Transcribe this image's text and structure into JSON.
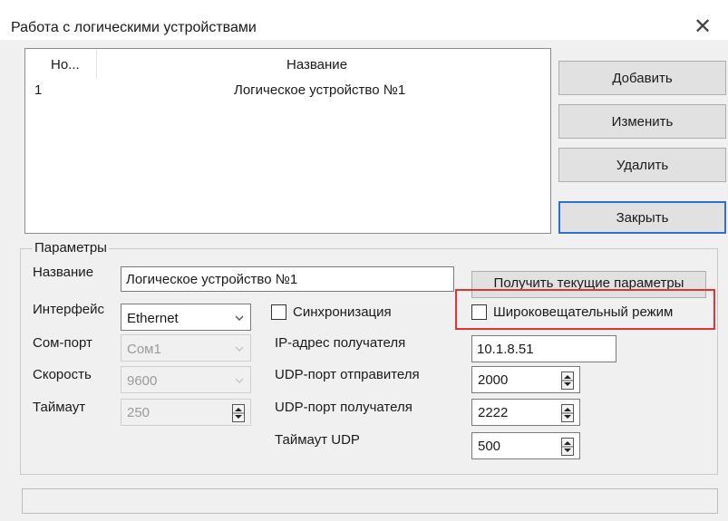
{
  "window": {
    "title": "Работа с логическими устройствами",
    "close_glyph": "✕"
  },
  "list": {
    "columns": [
      "Но...",
      "Название"
    ],
    "rows": [
      {
        "no": "1",
        "name": "Логическое устройство №1"
      }
    ]
  },
  "buttons": {
    "add": "Добавить",
    "edit": "Изменить",
    "delete": "Удалить",
    "close": "Закрыть",
    "get_params": "Получить текущие параметры"
  },
  "params": {
    "group_label": "Параметры",
    "name_label": "Название",
    "name_value": "Логическое устройство №1",
    "interface_label": "Интерфейс",
    "interface_value": "Ethernet",
    "comport_label": "Сом-порт",
    "comport_value": "Сом1",
    "speed_label": "Скорость",
    "speed_value": "9600",
    "timeout_label": "Таймаут",
    "timeout_value": "250",
    "sync_label": "Синхронизация",
    "broadcast_label": "Широковещательный режим",
    "ip_label": "IP-адрес получателя",
    "ip_value": "10.1.8.51",
    "udp_send_label": "UDP-порт отправителя",
    "udp_send_value": "2000",
    "udp_recv_label": "UDP-порт получателя",
    "udp_recv_value": "2222",
    "udp_timeout_label": "Таймаут UDP",
    "udp_timeout_value": "500"
  },
  "colors": {
    "highlight": "#e03434",
    "default_button_border": "#2a6fd1"
  }
}
